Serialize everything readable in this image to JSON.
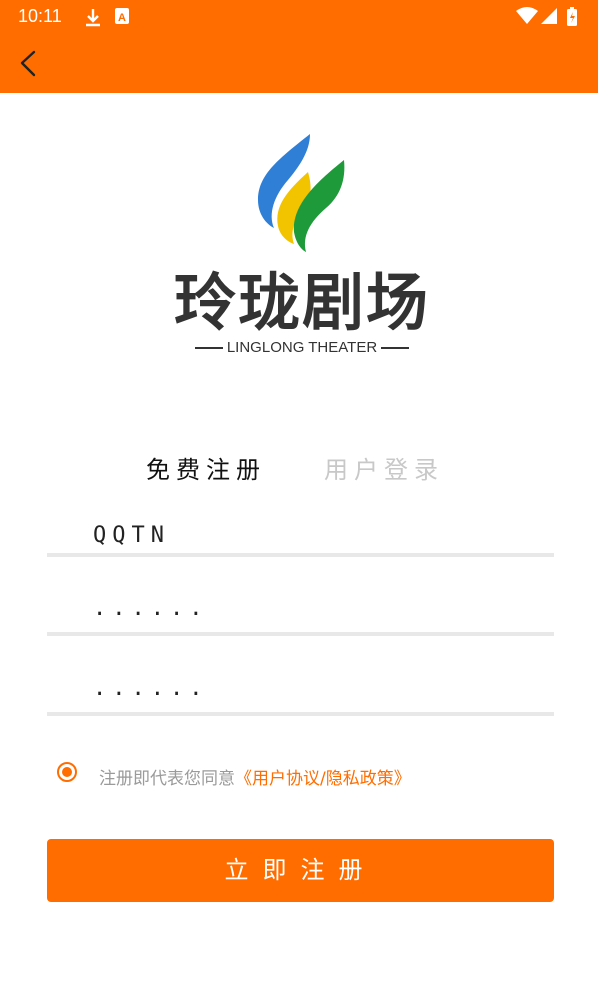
{
  "status_bar": {
    "time": "10:11",
    "icons": [
      "download-icon",
      "notification-a-icon",
      "wifi-icon",
      "cell-signal-icon",
      "battery-icon"
    ]
  },
  "header": {
    "back_icon": "chevron-left-icon",
    "accent_color": "#ff6d00"
  },
  "logo": {
    "name": "玲珑剧场",
    "subtitle": "LINGLONG THEATER",
    "colors": [
      "#2f7fd6",
      "#f2c400",
      "#1f9a3a"
    ]
  },
  "tabs": [
    {
      "label": "免费注册",
      "active": true
    },
    {
      "label": "用户登录",
      "active": false
    }
  ],
  "form": {
    "username": "QQTN",
    "password_masked": "......",
    "confirm_masked": "......"
  },
  "agreement": {
    "text": "注册即代表您同意",
    "link": "《用户协议/隐私政策》",
    "checked": true
  },
  "submit": {
    "label": "立即注册"
  }
}
